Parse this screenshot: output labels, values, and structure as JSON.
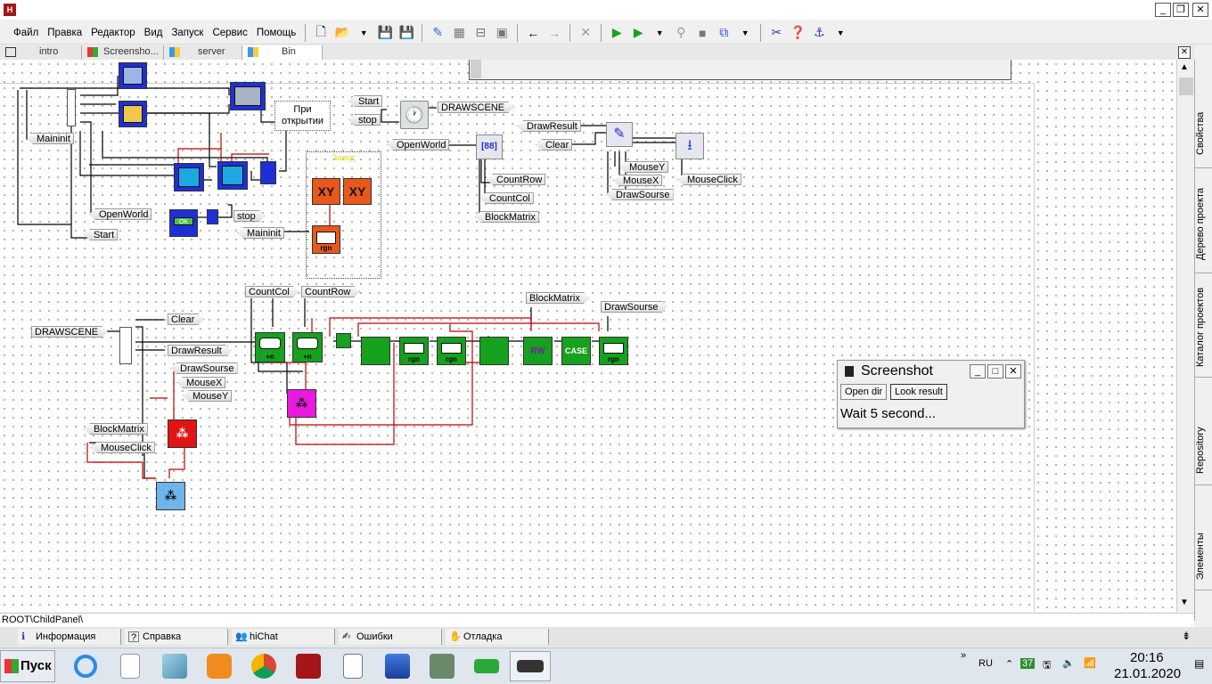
{
  "window": {
    "minimize_label": "_",
    "restore_label": "❐",
    "close_label": "✕"
  },
  "menu": {
    "items": [
      "Файл",
      "Правка",
      "Редактор",
      "Вид",
      "Запуск",
      "Сервис",
      "Помощь"
    ]
  },
  "toolbar": {
    "icons": [
      "new-file-icon",
      "open-folder-icon",
      "save-icon",
      "save-all-icon",
      "edit-icon",
      "align-icon",
      "center-icon",
      "fit-icon",
      "undo-icon",
      "redo-icon",
      "delete-icon",
      "run-icon",
      "debug-run-icon",
      "step-icon",
      "stop-icon",
      "compile-icon",
      "tools-icon",
      "help-icon",
      "anchor-icon"
    ]
  },
  "tabs": [
    {
      "label": "intro",
      "active": false
    },
    {
      "label": "Screensho...",
      "active": false
    },
    {
      "label": "server",
      "active": false
    },
    {
      "label": "Bin",
      "active": true
    }
  ],
  "sidebar_right": {
    "items": [
      "Свойства",
      "Дерево проекта",
      "Каталог проектов",
      "Repository",
      "Элементы"
    ]
  },
  "breadcrumb": "ROOT\\ChildPanel\\",
  "bottom_tabs": [
    {
      "label": "Информация",
      "icon": "info-icon"
    },
    {
      "label": "Справка",
      "icon": "help-icon"
    },
    {
      "label": "hiChat",
      "icon": "chat-icon"
    },
    {
      "label": "Ошибки",
      "icon": "errors-icon"
    },
    {
      "label": "Отладка",
      "icon": "debug-icon"
    }
  ],
  "diagram": {
    "comment": "При открытии",
    "group_title": "Завод",
    "labels": {
      "maininit_1": "Maininit",
      "openworld_1": "OpenWorld",
      "start_1": "Start",
      "stop_1": "stop",
      "maininit_2": "Maininit",
      "start_2": "Start",
      "stop_2": "stop",
      "drawscene_1": "DRAWSCENE",
      "openworld_2": "OpenWorld",
      "countrow_1": "CountRow",
      "countcol_1": "CountCol",
      "blockmatrix_1": "BlockMatrix",
      "drawresult_1": "DrawResult",
      "clear_1": "Clear",
      "mousey_1": "MouseY",
      "mousex_1": "MouseX",
      "drawsourse_1": "DrawSourse",
      "mouseclick_1": "MouseClick",
      "countcol_2": "CountCol",
      "countrow_2": "CountRow",
      "blockmatrix_2": "BlockMatrix",
      "drawsourse_2": "DrawSourse",
      "drawscene_2": "DRAWSCENE",
      "clear_2": "Clear",
      "drawresult_2": "DrawResult",
      "drawsourse_3": "DrawSourse",
      "mousex_2": "MouseX",
      "mousey_2": "MouseY",
      "blockmatrix_3": "BlockMatrix",
      "mouseclick_2": "MouseClick"
    },
    "node_text": {
      "xy": "XY",
      "rgn": "rgn",
      "n": "+n",
      "case": "CASE",
      "ok": "OK"
    }
  },
  "dialog": {
    "title": "Screenshot",
    "open_dir": "Open dir",
    "look_result": "Look result",
    "message": "Wait 5 second..."
  },
  "taskbar": {
    "start_label": "Пуск",
    "language": "RU",
    "badge": "37",
    "time": "20:16",
    "date": "21.01.2020",
    "apps": [
      "ie-icon",
      "file-icon",
      "notepad-icon",
      "media-icon",
      "chrome-icon",
      "hiasm-icon",
      "docx-icon",
      "apps-icon",
      "network-icon",
      "board-icon",
      "chip-icon"
    ]
  }
}
